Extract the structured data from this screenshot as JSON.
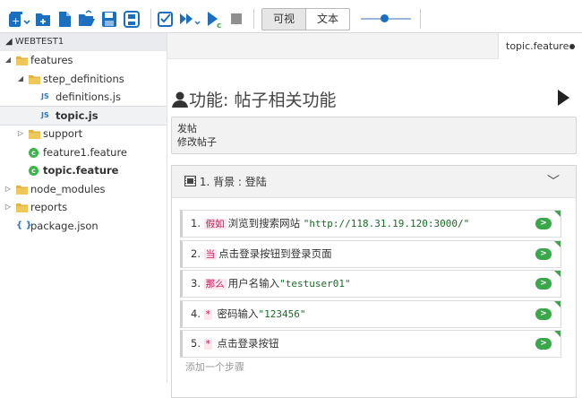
{
  "toolbar": {
    "view_toggle": {
      "visual_label": "可视",
      "text_label": "文本",
      "selected": "可视"
    },
    "zoom_level_fraction": 0.45,
    "icons": [
      "new-file-icon",
      "open-folder-icon",
      "new-document-icon",
      "open-icon",
      "save-icon",
      "save-all-icon",
      "validate-icon",
      "run-all-icon",
      "run-coverage-icon",
      "stop-icon"
    ]
  },
  "sidebar": {
    "root_label": "WEBTEST1",
    "tree": [
      {
        "label": "features",
        "type": "folder",
        "expanded": true
      },
      {
        "label": "step_definitions",
        "type": "folder",
        "expanded": true
      },
      {
        "label": "definitions.js",
        "type": "js"
      },
      {
        "label": "topic.js",
        "type": "js",
        "selected": true
      },
      {
        "label": "support",
        "type": "folder",
        "expanded": false
      },
      {
        "label": "feature1.feature",
        "type": "feature"
      },
      {
        "label": "topic.feature",
        "type": "feature"
      },
      {
        "label": "node_modules",
        "type": "folder",
        "expanded": false
      },
      {
        "label": "reports",
        "type": "folder",
        "expanded": false
      },
      {
        "label": "package.json",
        "type": "json"
      }
    ]
  },
  "editor": {
    "tab_label": "topic.feature",
    "feature_title": "功能: 帖子相关功能",
    "description_lines": [
      "发帖",
      "修改帖子"
    ],
    "background_header": "1. 背景 : 登陆",
    "steps": [
      {
        "num": "1.",
        "keyword": "假如",
        "text": "浏览到搜索网站 ",
        "arg": "\"http://118.31.19.120:3000/\""
      },
      {
        "num": "2.",
        "keyword": "当",
        "text": "点击登录按钮到登录页面",
        "arg": ""
      },
      {
        "num": "3.",
        "keyword": "那么",
        "text": "用户名输入",
        "arg": "\"testuser01\""
      },
      {
        "num": "4.",
        "keyword": "*",
        "text": " 密码输入",
        "arg": "\"123456\""
      },
      {
        "num": "5.",
        "keyword": "*",
        "text": " 点击登录按钮",
        "arg": ""
      }
    ],
    "add_step_label": "添加一个步骤",
    "colors": {
      "accent": "#1c6fbf",
      "run_green": "#3aa84a",
      "keyword": "#c2185b"
    }
  }
}
